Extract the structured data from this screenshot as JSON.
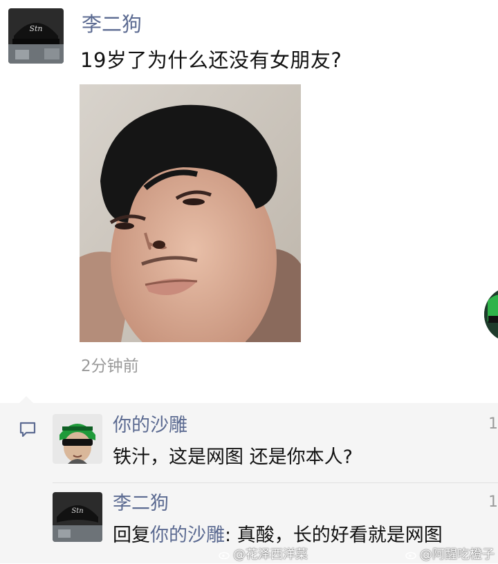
{
  "post": {
    "author": "李二狗",
    "text": "19岁了为什么还没有女朋友?",
    "time": "2分钟前"
  },
  "comments": [
    {
      "author": "你的沙雕",
      "text": "铁汁，这是网图  还是你本人?",
      "time": "1"
    },
    {
      "author": "李二狗",
      "reply_prefix": "回复",
      "reply_to": "你的沙雕",
      "reply_colon": ":",
      "text": " 真酸，长的好看就是网图",
      "time": "1"
    }
  ],
  "watermarks": [
    "@花泽西洋菜",
    "@阿醒吃橙子"
  ],
  "colors": {
    "name_link": "#5b6a91",
    "comment_bg": "#f5f5f5",
    "time_gray": "#9a9a9a"
  },
  "icons": [
    "comment-icon",
    "weibo-icon"
  ]
}
